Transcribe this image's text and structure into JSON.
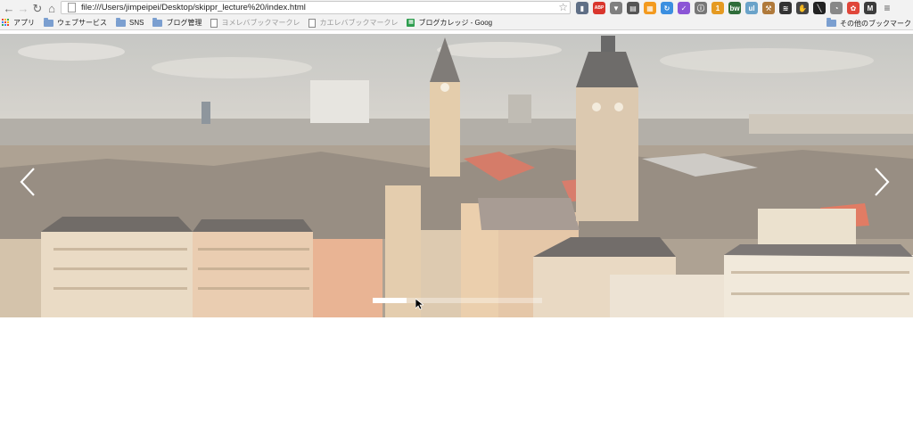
{
  "browser": {
    "url": "file:///Users/jimpeipei/Desktop/skippr_lecture%20/index.html",
    "extensions": [
      {
        "name": "bookmark-ext-icon",
        "color": "#5f6f86",
        "glyph": "▮"
      },
      {
        "name": "abp-ext-icon",
        "color": "#d9362d",
        "glyph": "ABP"
      },
      {
        "name": "pocket-ext-icon",
        "color": "#7f7f7f",
        "glyph": "▼"
      },
      {
        "name": "notes-ext-icon",
        "color": "#555555",
        "glyph": "▤"
      },
      {
        "name": "feed-ext-icon",
        "color": "#f39a1e",
        "glyph": "▦"
      },
      {
        "name": "update-ext-icon",
        "color": "#3b8fe0",
        "glyph": "↻"
      },
      {
        "name": "check-ext-icon",
        "color": "#8b55d6",
        "glyph": "✓"
      },
      {
        "name": "info-ext-icon",
        "color": "#777777",
        "glyph": "ⓘ"
      },
      {
        "name": "one-ext-icon",
        "color": "#e59a21",
        "glyph": "1"
      },
      {
        "name": "bw-ext-icon",
        "color": "#2f6d3a",
        "glyph": "bw"
      },
      {
        "name": "ul-ext-icon",
        "color": "#6aa3c9",
        "glyph": "ul"
      },
      {
        "name": "hammer-ext-icon",
        "color": "#b07a3b",
        "glyph": "⚒"
      },
      {
        "name": "layers-ext-icon",
        "color": "#333333",
        "glyph": "≋"
      },
      {
        "name": "hand-ext-icon",
        "color": "#444444",
        "glyph": "✋"
      },
      {
        "name": "slash-ext-icon",
        "color": "#222222",
        "glyph": "╲"
      },
      {
        "name": "timer-ext-icon",
        "color": "#888888",
        "glyph": "◔"
      },
      {
        "name": "color-wheel-ext-icon",
        "color": "#e0463a",
        "glyph": "✿"
      },
      {
        "name": "m-ext-icon",
        "color": "#3c3c3c",
        "glyph": "M"
      },
      {
        "name": "menu-icon",
        "color": "#f2f2f2",
        "glyph": "≡"
      }
    ]
  },
  "bookmarks": {
    "items": [
      {
        "label": "アプリ",
        "type": "apps"
      },
      {
        "label": "ウェブサービス",
        "type": "folder"
      },
      {
        "label": "SNS",
        "type": "folder"
      },
      {
        "label": "ブログ管理",
        "type": "folder"
      },
      {
        "label": "ヨメレバブックマークレ",
        "type": "doc"
      },
      {
        "label": "カエレバブックマークレ",
        "type": "doc"
      },
      {
        "label": "ブログカレッジ - Goog",
        "type": "green"
      }
    ],
    "other_label": "その他のブックマーク"
  },
  "slider": {
    "progress": 0.2,
    "colors": {
      "sky": "#c9c5be",
      "track": "#ffffff"
    }
  }
}
